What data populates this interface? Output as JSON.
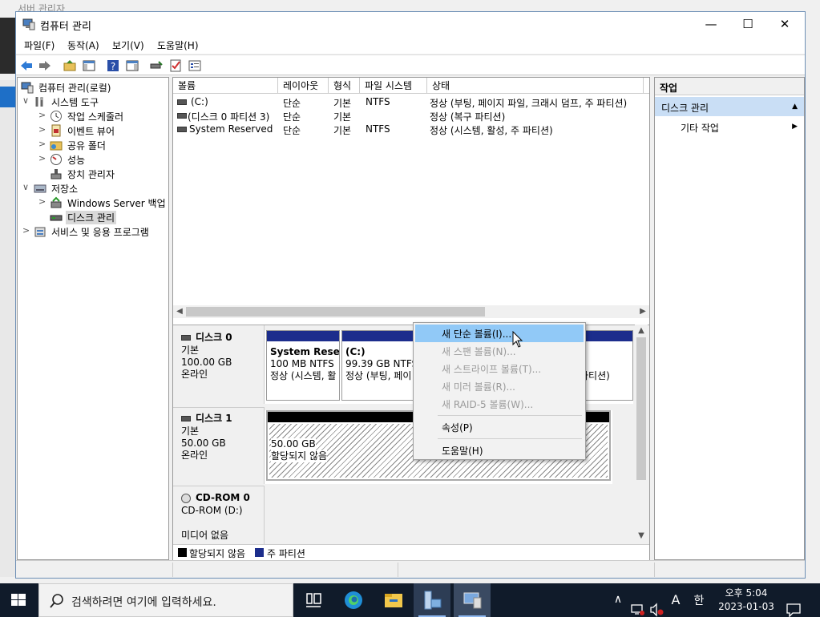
{
  "background_window": {
    "title": "서버 관리자"
  },
  "window": {
    "title": "컴퓨터 관리",
    "controls": {
      "minimize": "—",
      "maximize": "☐",
      "close": "✕"
    }
  },
  "menu": [
    "파일(F)",
    "동작(A)",
    "보기(V)",
    "도움말(H)"
  ],
  "tree": [
    {
      "label": "컴퓨터 관리(로컬)",
      "expander": "",
      "icon": "computer-management-icon"
    },
    {
      "label": "시스템 도구",
      "expander": "∨",
      "icon": "tools-icon"
    },
    {
      "label": "작업 스케줄러",
      "expander": ">",
      "icon": "clock-icon"
    },
    {
      "label": "이벤트 뷰어",
      "expander": ">",
      "icon": "event-viewer-icon"
    },
    {
      "label": "공유 폴더",
      "expander": ">",
      "icon": "shared-folder-icon"
    },
    {
      "label": "성능",
      "expander": ">",
      "icon": "performance-icon"
    },
    {
      "label": "장치 관리자",
      "expander": "",
      "icon": "device-manager-icon"
    },
    {
      "label": "저장소",
      "expander": "∨",
      "icon": "storage-icon"
    },
    {
      "label": "Windows Server 백업",
      "expander": ">",
      "icon": "backup-icon"
    },
    {
      "label": "디스크 관리",
      "expander": "",
      "icon": "disk-management-icon"
    },
    {
      "label": "서비스 및 응용 프로그램",
      "expander": ">",
      "icon": "services-icon"
    }
  ],
  "volume_list": {
    "columns": [
      "볼륨",
      "레이아웃",
      "형식",
      "파일 시스템",
      "상태"
    ],
    "rows": [
      {
        "volume": "(C:)",
        "layout": "단순",
        "type": "기본",
        "fs": "NTFS",
        "status": "정상 (부팅, 페이지 파일, 크래시 덤프, 주 파티션)"
      },
      {
        "volume": "(디스크 0 파티션 3)",
        "layout": "단순",
        "type": "기본",
        "fs": "",
        "status": "정상 (복구 파티션)"
      },
      {
        "volume": "System Reserved",
        "layout": "단순",
        "type": "기본",
        "fs": "NTFS",
        "status": "정상 (시스템, 활성, 주 파티션)"
      }
    ]
  },
  "disks": {
    "disk0": {
      "name": "디스크 0",
      "type": "기본",
      "size": "100.00 GB",
      "state": "온라인",
      "partitions": [
        {
          "name": "System Reser",
          "size": "100 MB NTFS",
          "status": "정상 (시스템, 활"
        },
        {
          "name": "(C:)",
          "size": "99.39 GB NTFS",
          "status": "정상 (부팅, 페이"
        },
        {
          "name": "",
          "size": "",
          "status": "파티션)"
        }
      ]
    },
    "disk1": {
      "name": "디스크 1",
      "type": "기본",
      "size": "50.00 GB",
      "state": "온라인",
      "unalloc_size": "50.00 GB",
      "unalloc_label": "할당되지 않음"
    },
    "cdrom0": {
      "name": "CD-ROM 0",
      "drive": "CD-ROM (D:)",
      "media": "미디어 없음"
    }
  },
  "legend": [
    {
      "label": "할당되지 않음",
      "color": "#000000"
    },
    {
      "label": "주 파티션",
      "color": "#1c2d8c"
    }
  ],
  "actions": {
    "header": "작업",
    "group": "디스크 관리",
    "item": "기타 작업"
  },
  "context_menu": {
    "items": [
      {
        "label": "새 단순 볼륨(I)...",
        "state": "highlighted"
      },
      {
        "label": "새 스팬 볼륨(N)...",
        "state": "disabled"
      },
      {
        "label": "새 스트라이프 볼륨(T)...",
        "state": "disabled"
      },
      {
        "label": "새 미러 볼륨(R)...",
        "state": "disabled"
      },
      {
        "label": "새 RAID-5 볼륨(W)...",
        "state": "disabled"
      },
      {
        "label": "속성(P)",
        "state": "enabled"
      },
      {
        "label": "도움말(H)",
        "state": "enabled"
      }
    ]
  },
  "taskbar": {
    "search_placeholder": "검색하려면 여기에 입력하세요.",
    "apps": [
      "task-view-icon",
      "edge-icon",
      "file-explorer-icon",
      "server-manager-icon",
      "computer-management-icon"
    ],
    "tray": {
      "chevron": "∧",
      "ime_mode": "A",
      "ime_lang": "한"
    },
    "clock": {
      "time": "오후 5:04",
      "date": "2023-01-03"
    }
  },
  "colors": {
    "primary_partition": "#1c2d8c",
    "unallocated": "#000000",
    "menu_highlight": "#91c9f7",
    "actions_group": "#c9def5"
  }
}
